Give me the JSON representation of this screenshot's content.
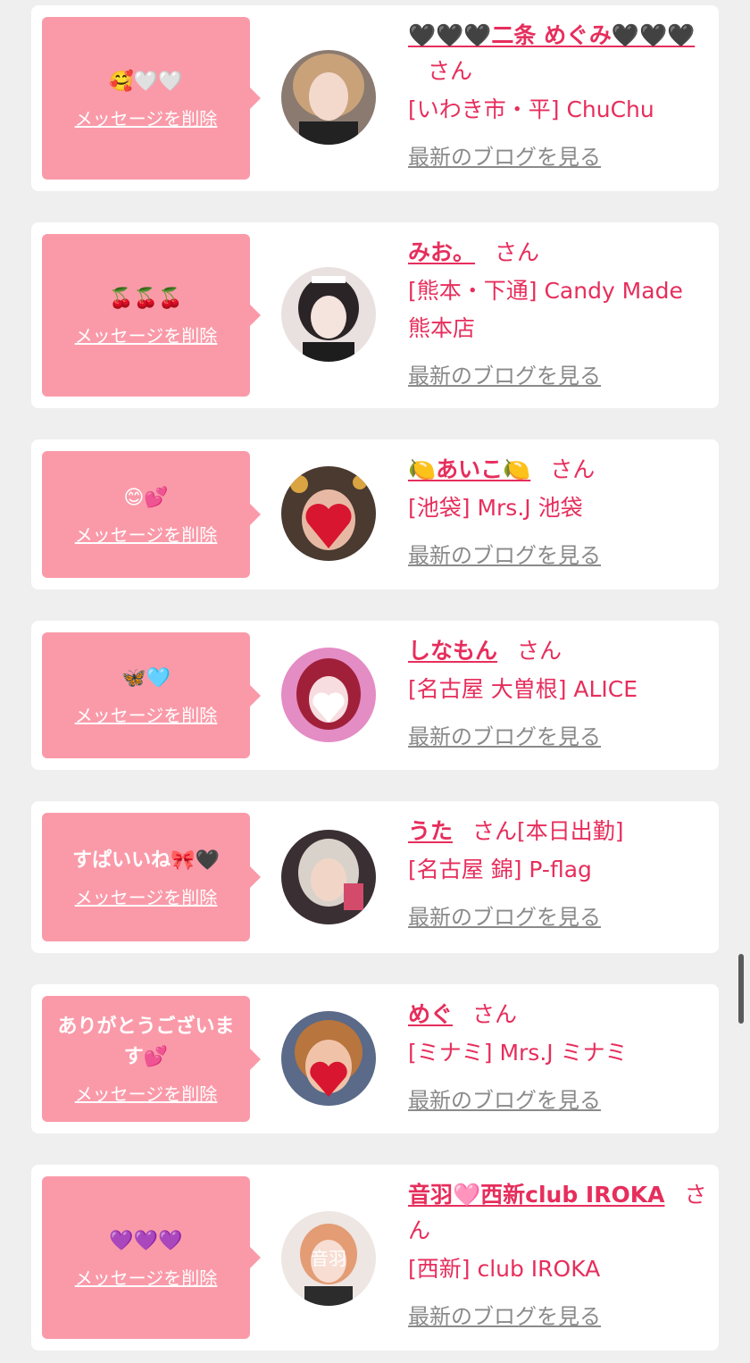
{
  "delete_label": "メッセージを削除",
  "blog_label": "最新のブログを見る",
  "san_label": "さん",
  "colors": {
    "accent": "#e62e5c",
    "bubble": "#fa9aa9",
    "muted": "#8a8a8a"
  },
  "items": [
    {
      "message": "🥰🤍🤍",
      "name": "🖤🖤🖤二条 めぐみ🖤🖤🖤",
      "status": "",
      "shop": "[いわき市・平] ChuChu"
    },
    {
      "message": "🍒🍒🍒",
      "name": "みお。",
      "status": "",
      "shop": "[熊本・下通] Candy Made 熊本店"
    },
    {
      "message": "😊💕",
      "name": "🍋あいこ🍋",
      "status": "",
      "shop": "[池袋] Mrs.J 池袋"
    },
    {
      "message": "🦋🩵",
      "name": "しなもん",
      "status": "",
      "shop": "[名古屋 大曽根] ALICE"
    },
    {
      "message": "すぱいいね🎀🖤",
      "name": "うた",
      "status": "[本日出勤]",
      "shop": "[名古屋 錦] P-flag"
    },
    {
      "message": "ありがとうございます💕",
      "name": "めぐ",
      "status": "",
      "shop": "[ミナミ] Mrs.J ミナミ"
    },
    {
      "message": "💜💜💜",
      "name": "音羽🩷西新club IROKA",
      "status": "",
      "shop": "[西新] club IROKA"
    }
  ]
}
